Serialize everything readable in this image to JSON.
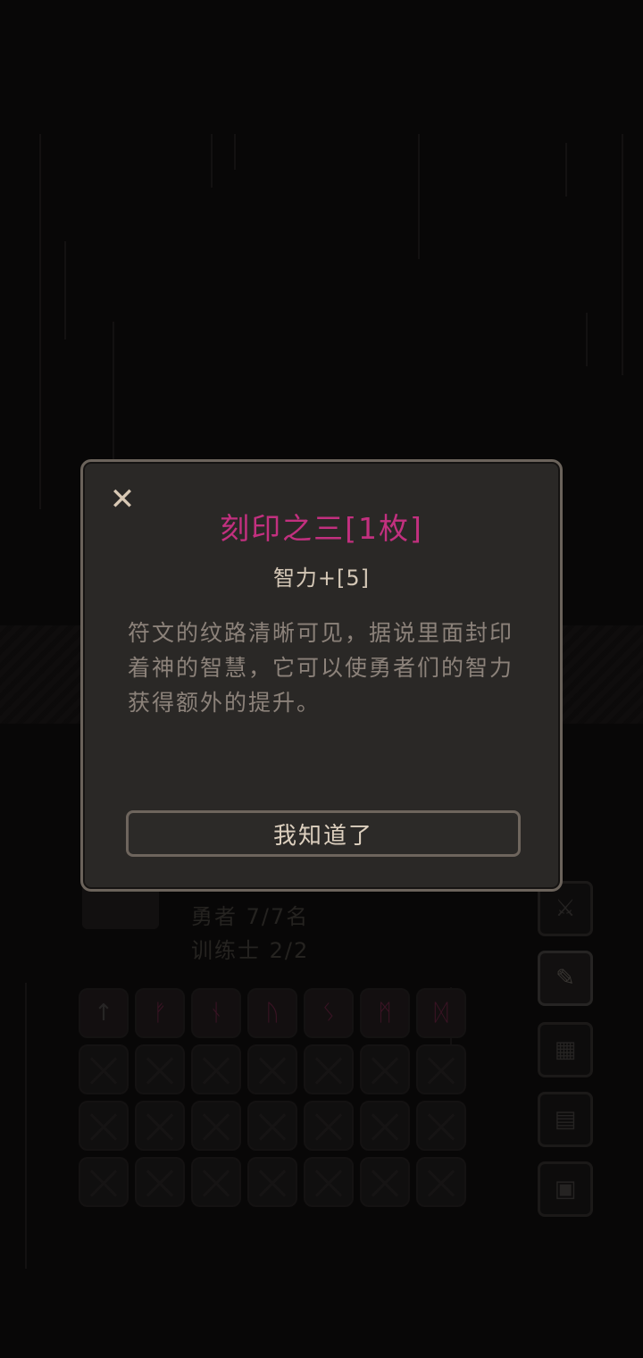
{
  "dialog": {
    "close_icon": "close-icon",
    "title": "刻印之三[1枚]",
    "stat": "智力+[5]",
    "description": "符文的纹路清晰可见，据说里面封印着神的智慧，它可以使勇者们的智力获得额外的提升。",
    "confirm_label": "我知道了",
    "title_color": "#c2307f"
  },
  "panel": {
    "heroes": "勇者 7/7名",
    "trainers": "训练士 2/2",
    "runes": [
      {
        "icon": "arrow-up-rune-icon",
        "glyph": "↑"
      },
      {
        "icon": "rune-f-icon",
        "glyph": "ᚠ"
      },
      {
        "icon": "rune-n-icon",
        "glyph": "ᚾ"
      },
      {
        "icon": "rune-u-icon",
        "glyph": "ᚢ"
      },
      {
        "icon": "rune-s-icon",
        "glyph": "ᛊ"
      },
      {
        "icon": "rune-m-icon",
        "glyph": "ᛗ"
      },
      {
        "icon": "rune-d-icon",
        "glyph": "ᛞ"
      }
    ],
    "empty_slots": 21
  },
  "side_menu": [
    {
      "icon": "swords-icon",
      "glyph": "⚔"
    },
    {
      "icon": "scroll-icon",
      "glyph": "✎"
    },
    {
      "icon": "map-icon",
      "glyph": "▦"
    },
    {
      "icon": "document-icon",
      "glyph": "▤"
    },
    {
      "icon": "monitor-icon",
      "glyph": "▣"
    }
  ]
}
